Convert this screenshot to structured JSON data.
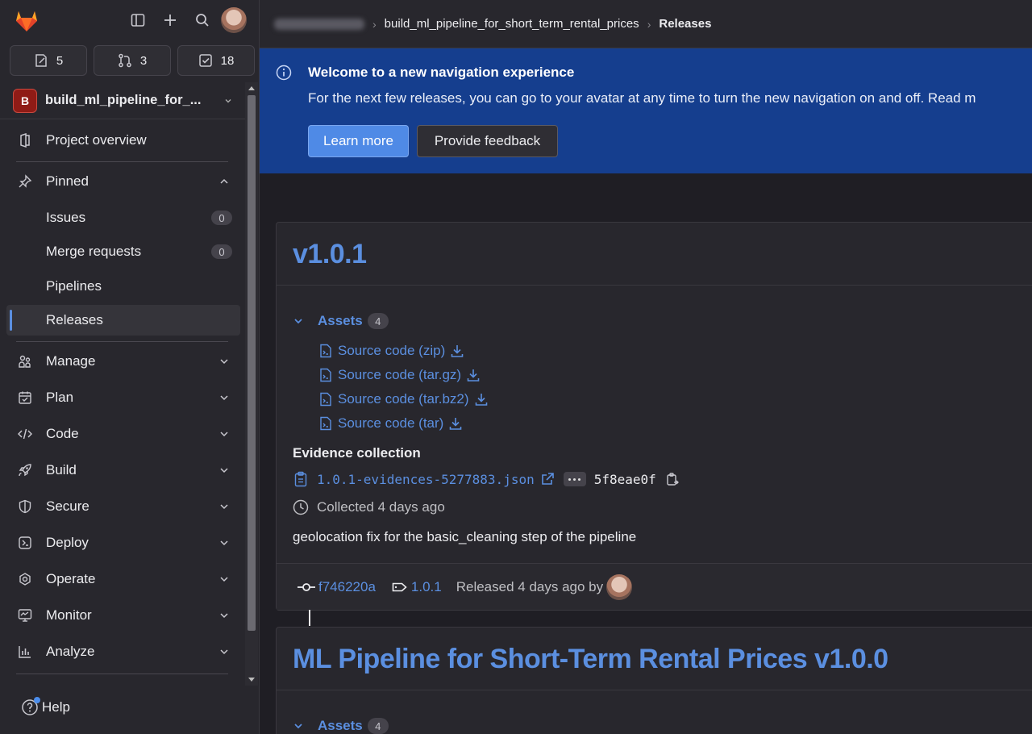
{
  "sidebar": {
    "counters": [
      {
        "icon": "issues-icon",
        "value": "5"
      },
      {
        "icon": "merge-request-icon",
        "value": "3"
      },
      {
        "icon": "todo-icon",
        "value": "18"
      }
    ],
    "project": {
      "badge": "B",
      "name": "build_ml_pipeline_for_..."
    },
    "project_overview": "Project overview",
    "pinned": "Pinned",
    "pinned_items": [
      {
        "label": "Issues",
        "count": "0"
      },
      {
        "label": "Merge requests",
        "count": "0"
      },
      {
        "label": "Pipelines"
      },
      {
        "label": "Releases"
      }
    ],
    "groups": [
      "Manage",
      "Plan",
      "Code",
      "Build",
      "Secure",
      "Deploy",
      "Operate",
      "Monitor",
      "Analyze"
    ],
    "help": "Help"
  },
  "breadcrumb": {
    "project": "build_ml_pipeline_for_short_term_rental_prices",
    "current": "Releases"
  },
  "banner": {
    "title": "Welcome to a new navigation experience",
    "text": "For the next few releases, you can go to your avatar at any time to turn the new navigation on and off. Read m",
    "learn_more": "Learn more",
    "feedback": "Provide feedback"
  },
  "releases": [
    {
      "title": "v1.0.1",
      "assets_label": "Assets",
      "assets_count": "4",
      "assets": [
        "Source code (zip)",
        "Source code (tar.gz)",
        "Source code (tar.bz2)",
        "Source code (tar)"
      ],
      "evidence_title": "Evidence collection",
      "evidence_file": "1.0.1-evidences-5277883.json",
      "evidence_sha": "5f8eae0f",
      "collected": "Collected 4 days ago",
      "description": "geolocation fix for the basic_cleaning step of the pipeline",
      "commit": "f746220a",
      "tag": "1.0.1",
      "released": "Released 4 days ago by"
    },
    {
      "title": "ML Pipeline for Short-Term Rental Prices v1.0.0",
      "assets_label": "Assets",
      "assets_count": "4"
    }
  ],
  "colors": {
    "accent": "#5b8fe0",
    "banner": "#153e8e",
    "sidebar": "#28272d"
  }
}
